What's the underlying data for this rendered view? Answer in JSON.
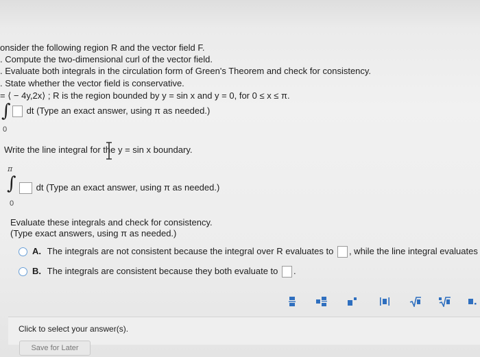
{
  "problem": {
    "line1": "onsider the following region R and the vector field F.",
    "line2": ". Compute the two-dimensional curl of the vector field.",
    "line3": ". Evaluate both integrals in the circulation form of Green's Theorem and check for consistency.",
    "line4": ". State whether the vector field is conservative.",
    "line5": "= ⟨ − 4y,2x⟩ ; R is the region bounded by y = sin x and y = 0, for 0 ≤ x ≤ π.",
    "first_integral_suffix": "dt (Type an exact answer, using π as needed.)",
    "first_integral_lower": "0"
  },
  "line_integral": {
    "prompt": "Write the line integral for the y = sin x boundary.",
    "upper_limit": "π",
    "lower_limit": "0",
    "suffix": "dt (Type an exact answer, using π as needed.)"
  },
  "consistency": {
    "prompt1": "Evaluate these integrals and check for consistency.",
    "prompt2": "(Type exact answers, using π as needed.)",
    "options": [
      {
        "letter": "A.",
        "text_before": "The integrals are not consistent because the integral over R evaluates to",
        "text_after": ", while the line integral evaluates to"
      },
      {
        "letter": "B.",
        "text_before": "The integrals are consistent because they both evaluate to",
        "text_after": "."
      }
    ]
  },
  "toolbar": {
    "buttons": [
      "fraction-icon",
      "mixed-number-icon",
      "exponent-icon",
      "absolute-value-icon",
      "sqrt-icon",
      "nth-root-icon",
      "decimal-icon"
    ]
  },
  "footer": {
    "instruction": "Click to select your answer(s).",
    "save_label": "Save for Later"
  },
  "colors": {
    "accent": "#2f6fbf",
    "radio_border": "#6aa0d8"
  }
}
